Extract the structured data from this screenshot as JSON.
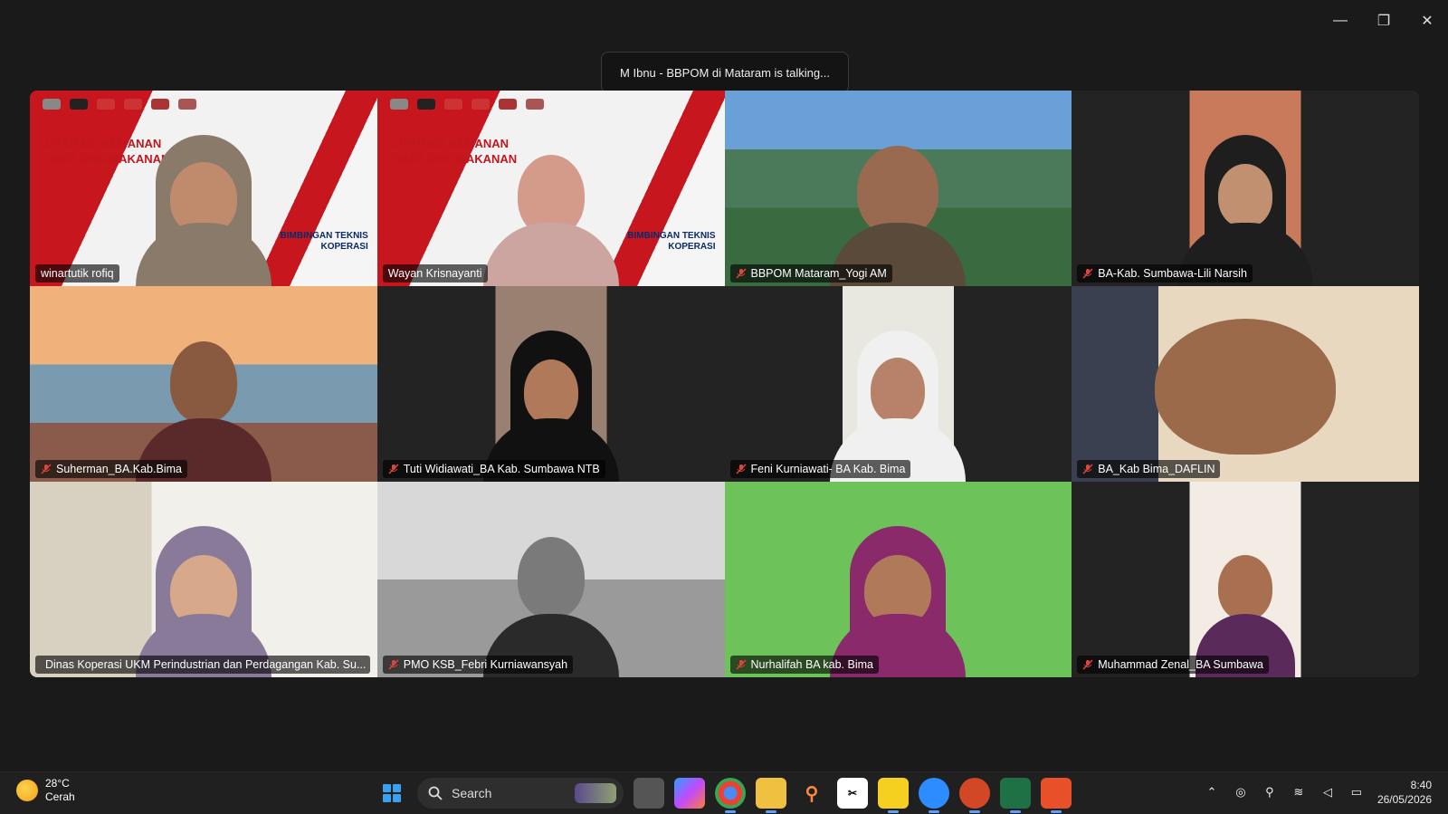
{
  "notification": {
    "talking": "M Ibnu - BBPOM di Mataram is talking..."
  },
  "window_controls": {
    "minimize": "—",
    "restore": "❐",
    "close": "✕"
  },
  "banner": {
    "title_line1": "LITERASI KEMANAN",
    "title_line2": "OBAT DAN MAKANAN",
    "sub_line1": "BIMBINGAN TEKNIS",
    "sub_line2": "KOPERASI"
  },
  "participants": [
    {
      "name": "winartutik rofiq",
      "muted": false,
      "style": "banner"
    },
    {
      "name": "Wayan Krisnayanti",
      "muted": false,
      "style": "banner"
    },
    {
      "name": "BBPOM Mataram_Yogi AM",
      "muted": true,
      "style": "scenic"
    },
    {
      "name": "BA-Kab. Sumbawa-Lili Narsih",
      "muted": true,
      "style": "portrait-wall"
    },
    {
      "name": "Suherman_BA.Kab.Bima",
      "muted": true,
      "style": "bridge"
    },
    {
      "name": "Tuti Widiawati_BA Kab. Sumbawa NTB",
      "muted": true,
      "style": "portrait-dark"
    },
    {
      "name": "Feni Kurniawati- BA Kab. Bima",
      "muted": true,
      "style": "portrait-light"
    },
    {
      "name": "BA_Kab Bima_DAFLIN",
      "muted": true,
      "style": "closeup"
    },
    {
      "name": "Dinas Koperasi UKM Perindustrian dan Perdagangan Kab. Su...",
      "muted": true,
      "style": "office"
    },
    {
      "name": "PMO KSB_Febri Kurniawansyah",
      "muted": true,
      "style": "grey-room"
    },
    {
      "name": "Nurhalifah BA kab. Bima",
      "muted": true,
      "style": "green-wall"
    },
    {
      "name": "Muhammad Zenal_BA Sumbawa",
      "muted": true,
      "style": "portrait-batik"
    }
  ],
  "taskbar": {
    "weather_temp": "28°C",
    "weather_desc": "Cerah",
    "search_label": "Search",
    "time": "8:40",
    "date": "26/05/2026"
  },
  "colors": {
    "accent": "#5aa0ff",
    "muted_red": "#e0443a"
  }
}
